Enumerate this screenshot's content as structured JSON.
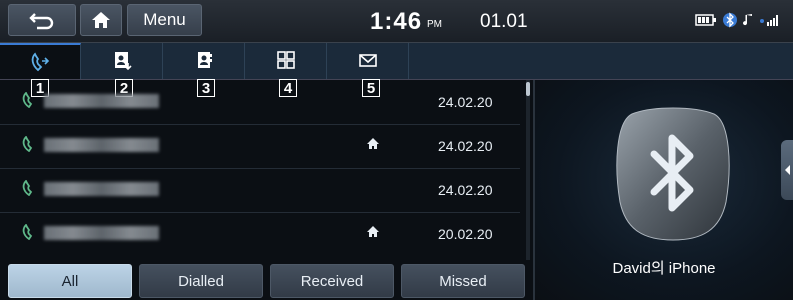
{
  "header": {
    "menu_label": "Menu",
    "time": "1:46",
    "ampm": "PM",
    "date": "01.01"
  },
  "tabs": [
    {
      "icon": "call-history-icon",
      "callout": "1"
    },
    {
      "icon": "contacts-download-icon",
      "callout": "2"
    },
    {
      "icon": "favorites-icon",
      "callout": "3"
    },
    {
      "icon": "keypad-icon",
      "callout": "4"
    },
    {
      "icon": "message-icon",
      "callout": "5"
    }
  ],
  "calls": [
    {
      "date": "24.02.20",
      "home": false
    },
    {
      "date": "24.02.20",
      "home": true
    },
    {
      "date": "24.02.20",
      "home": false
    },
    {
      "date": "20.02.20",
      "home": true
    }
  ],
  "filters": {
    "all": "All",
    "dialled": "Dialled",
    "received": "Received",
    "missed": "Missed"
  },
  "device": {
    "name": "David의 iPhone"
  },
  "colors": {
    "accent": "#3a7bd5",
    "active_filter": "#bcd3e6",
    "phone_icon": "#5fb88a"
  }
}
